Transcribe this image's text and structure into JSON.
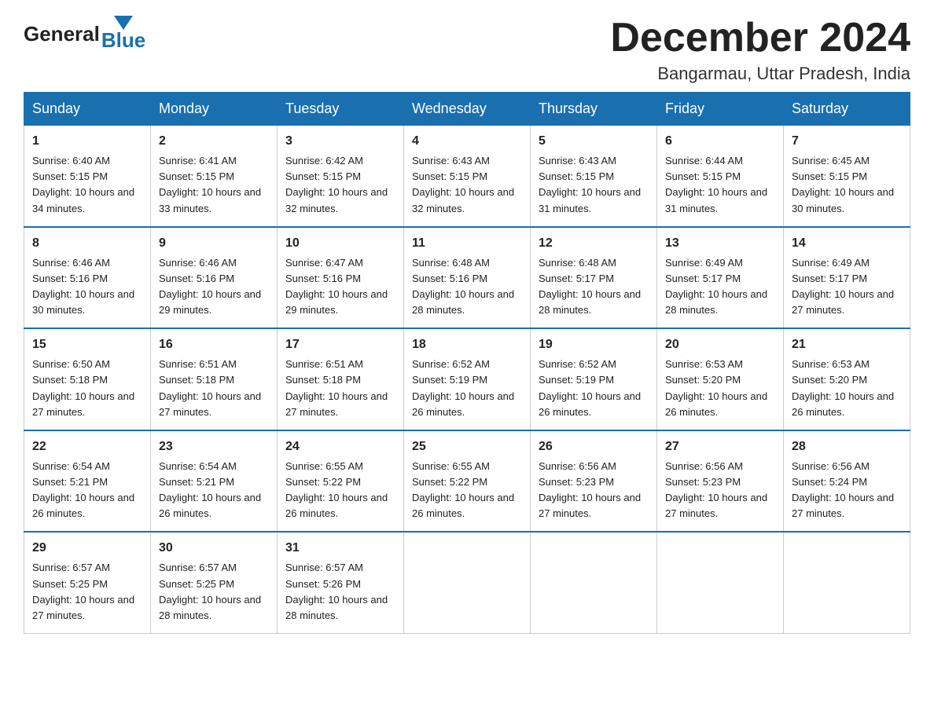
{
  "logo": {
    "general": "General",
    "blue": "Blue",
    "arrow": "▼"
  },
  "title": {
    "month_year": "December 2024",
    "location": "Bangarmau, Uttar Pradesh, India"
  },
  "headers": [
    "Sunday",
    "Monday",
    "Tuesday",
    "Wednesday",
    "Thursday",
    "Friday",
    "Saturday"
  ],
  "weeks": [
    [
      {
        "day": "1",
        "sunrise": "6:40 AM",
        "sunset": "5:15 PM",
        "daylight": "10 hours and 34 minutes."
      },
      {
        "day": "2",
        "sunrise": "6:41 AM",
        "sunset": "5:15 PM",
        "daylight": "10 hours and 33 minutes."
      },
      {
        "day": "3",
        "sunrise": "6:42 AM",
        "sunset": "5:15 PM",
        "daylight": "10 hours and 32 minutes."
      },
      {
        "day": "4",
        "sunrise": "6:43 AM",
        "sunset": "5:15 PM",
        "daylight": "10 hours and 32 minutes."
      },
      {
        "day": "5",
        "sunrise": "6:43 AM",
        "sunset": "5:15 PM",
        "daylight": "10 hours and 31 minutes."
      },
      {
        "day": "6",
        "sunrise": "6:44 AM",
        "sunset": "5:15 PM",
        "daylight": "10 hours and 31 minutes."
      },
      {
        "day": "7",
        "sunrise": "6:45 AM",
        "sunset": "5:15 PM",
        "daylight": "10 hours and 30 minutes."
      }
    ],
    [
      {
        "day": "8",
        "sunrise": "6:46 AM",
        "sunset": "5:16 PM",
        "daylight": "10 hours and 30 minutes."
      },
      {
        "day": "9",
        "sunrise": "6:46 AM",
        "sunset": "5:16 PM",
        "daylight": "10 hours and 29 minutes."
      },
      {
        "day": "10",
        "sunrise": "6:47 AM",
        "sunset": "5:16 PM",
        "daylight": "10 hours and 29 minutes."
      },
      {
        "day": "11",
        "sunrise": "6:48 AM",
        "sunset": "5:16 PM",
        "daylight": "10 hours and 28 minutes."
      },
      {
        "day": "12",
        "sunrise": "6:48 AM",
        "sunset": "5:17 PM",
        "daylight": "10 hours and 28 minutes."
      },
      {
        "day": "13",
        "sunrise": "6:49 AM",
        "sunset": "5:17 PM",
        "daylight": "10 hours and 28 minutes."
      },
      {
        "day": "14",
        "sunrise": "6:49 AM",
        "sunset": "5:17 PM",
        "daylight": "10 hours and 27 minutes."
      }
    ],
    [
      {
        "day": "15",
        "sunrise": "6:50 AM",
        "sunset": "5:18 PM",
        "daylight": "10 hours and 27 minutes."
      },
      {
        "day": "16",
        "sunrise": "6:51 AM",
        "sunset": "5:18 PM",
        "daylight": "10 hours and 27 minutes."
      },
      {
        "day": "17",
        "sunrise": "6:51 AM",
        "sunset": "5:18 PM",
        "daylight": "10 hours and 27 minutes."
      },
      {
        "day": "18",
        "sunrise": "6:52 AM",
        "sunset": "5:19 PM",
        "daylight": "10 hours and 26 minutes."
      },
      {
        "day": "19",
        "sunrise": "6:52 AM",
        "sunset": "5:19 PM",
        "daylight": "10 hours and 26 minutes."
      },
      {
        "day": "20",
        "sunrise": "6:53 AM",
        "sunset": "5:20 PM",
        "daylight": "10 hours and 26 minutes."
      },
      {
        "day": "21",
        "sunrise": "6:53 AM",
        "sunset": "5:20 PM",
        "daylight": "10 hours and 26 minutes."
      }
    ],
    [
      {
        "day": "22",
        "sunrise": "6:54 AM",
        "sunset": "5:21 PM",
        "daylight": "10 hours and 26 minutes."
      },
      {
        "day": "23",
        "sunrise": "6:54 AM",
        "sunset": "5:21 PM",
        "daylight": "10 hours and 26 minutes."
      },
      {
        "day": "24",
        "sunrise": "6:55 AM",
        "sunset": "5:22 PM",
        "daylight": "10 hours and 26 minutes."
      },
      {
        "day": "25",
        "sunrise": "6:55 AM",
        "sunset": "5:22 PM",
        "daylight": "10 hours and 26 minutes."
      },
      {
        "day": "26",
        "sunrise": "6:56 AM",
        "sunset": "5:23 PM",
        "daylight": "10 hours and 27 minutes."
      },
      {
        "day": "27",
        "sunrise": "6:56 AM",
        "sunset": "5:23 PM",
        "daylight": "10 hours and 27 minutes."
      },
      {
        "day": "28",
        "sunrise": "6:56 AM",
        "sunset": "5:24 PM",
        "daylight": "10 hours and 27 minutes."
      }
    ],
    [
      {
        "day": "29",
        "sunrise": "6:57 AM",
        "sunset": "5:25 PM",
        "daylight": "10 hours and 27 minutes."
      },
      {
        "day": "30",
        "sunrise": "6:57 AM",
        "sunset": "5:25 PM",
        "daylight": "10 hours and 28 minutes."
      },
      {
        "day": "31",
        "sunrise": "6:57 AM",
        "sunset": "5:26 PM",
        "daylight": "10 hours and 28 minutes."
      },
      null,
      null,
      null,
      null
    ]
  ],
  "labels": {
    "sunrise": "Sunrise:",
    "sunset": "Sunset:",
    "daylight": "Daylight:"
  }
}
